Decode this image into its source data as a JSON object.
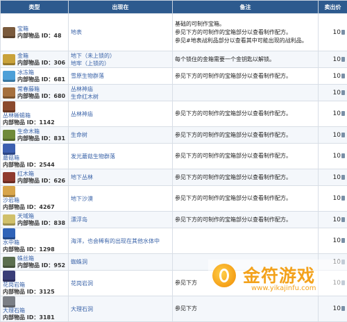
{
  "header": {
    "col_type": "类型",
    "col_loc": "出现在",
    "col_note": "备注",
    "col_price": "卖出价"
  },
  "iid_label": "内部物品 ID：",
  "rows": [
    {
      "name": "宝箱",
      "id": "48",
      "color": "#7a5a3c",
      "loc1": "地表",
      "loc2": "",
      "note1": "基础的可制作宝箱。",
      "note2": "参见下方的可制作的宝箱部分以查看制作配方。",
      "note3": "参见#地表战利品部分以查看其中可能出现的战利品。",
      "price": "10",
      "extra": ""
    },
    {
      "name": "金箱",
      "id": "306",
      "color": "#c9a23a",
      "loc1": "地下（未上锁的）",
      "loc2": "地牢（上锁的）",
      "note1": "每个锁住的金箱需要一个金钥匙以解锁。",
      "note2": "",
      "note3": "",
      "price": "10",
      "extra": ""
    },
    {
      "name": "冰冻箱",
      "id": "681",
      "color": "#4da0d8",
      "loc1": "雪原生物群落",
      "loc2": "",
      "note1": "参见下方的可制作的宝箱部分以查看制作配方。",
      "note2": "",
      "note3": "",
      "price": "10",
      "extra": ""
    },
    {
      "name": "常春藤箱",
      "id": "680",
      "color": "#a5703d",
      "loc1": "丛林神庙",
      "loc2": "生命红木树",
      "note1": "",
      "note2": "",
      "note3": "",
      "price": "10",
      "extra": ""
    },
    {
      "name": "丛林蜥蜴箱",
      "id": "1142",
      "color": "#8b4a2e",
      "loc1": "丛林神庙",
      "loc2": "",
      "note1": "参见下方的可制作的宝箱部分以查看制作配方。",
      "note2": "",
      "note3": "",
      "price": "10",
      "extra": ""
    },
    {
      "name": "生命木箱",
      "id": "831",
      "color": "#6f8a3a",
      "loc1": "生命树",
      "loc2": "",
      "note1": "参见下方的可制作的宝箱部分以查看制作配方。",
      "note2": "",
      "note3": "",
      "price": "10",
      "extra": ""
    },
    {
      "name": "蘑菇箱",
      "id": "2544",
      "color": "#3c5fb0",
      "loc1": "发光蘑菇生物群落",
      "loc2": "",
      "note1": "参见下方的可制作的宝箱部分以查看制作配方。",
      "note2": "",
      "note3": "",
      "price": "10",
      "extra": ""
    },
    {
      "name": "红木箱",
      "id": "626",
      "color": "#8f3b2f",
      "loc1": "地下丛林",
      "loc2": "",
      "note1": "参见下方的可制作的宝箱部分以查看制作配方。",
      "note2": "",
      "note3": "",
      "price": "10",
      "extra": ""
    },
    {
      "name": "沙岩箱",
      "id": "4267",
      "color": "#d8a54a",
      "loc1": "地下沙漠",
      "loc2": "",
      "note1": "参见下方的可制作的宝箱部分以查看制作配方。",
      "note2": "",
      "note3": "",
      "price": "10",
      "extra": ""
    },
    {
      "name": "天域箱",
      "id": "838",
      "color": "#d0c06a",
      "loc1": "漂浮岛",
      "loc2": "",
      "note1": "参见下方的可制作的宝箱部分以查看制作配方。",
      "note2": "",
      "note3": "",
      "price": "10",
      "extra": ""
    },
    {
      "name": "水中箱",
      "id": "1298",
      "color": "#2f63b8",
      "loc1": "海洋，也会稀有的出现在其他水体中",
      "loc2": "",
      "note1": "",
      "note2": "",
      "note3": "",
      "price": "10",
      "extra": ""
    },
    {
      "name": "蛛丝箱",
      "id": "952",
      "color": "#5b6e4e",
      "loc1": "蜘蛛洞",
      "loc2": "",
      "note1": "",
      "note2": "",
      "note3": "",
      "price": "10",
      "extra": ""
    },
    {
      "name": "花岗岩箱",
      "id": "3125",
      "color": "#3a3e78",
      "loc1": "花岗岩洞",
      "loc2": "",
      "note1": "参见下方",
      "note2": "",
      "note3": "",
      "price": "10",
      "extra": ""
    },
    {
      "name": "大理石箱",
      "id": "3181",
      "color": "#7b7f86",
      "loc1": "大理石洞",
      "loc2": "",
      "note1": "参见下方",
      "note2": "",
      "note3": "",
      "price": "10",
      "extra": ""
    }
  ],
  "watermark": {
    "title": "金符游戏",
    "url": "www.yikajinfu.com"
  }
}
